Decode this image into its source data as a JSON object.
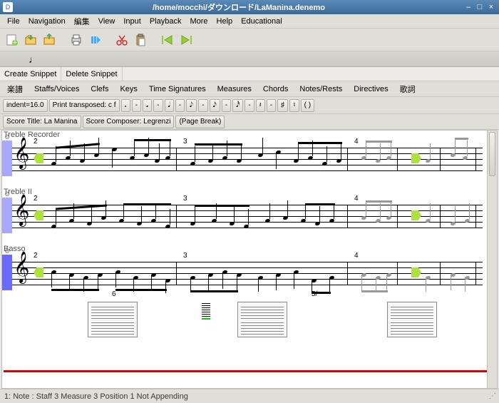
{
  "window": {
    "title": "/home/mocchi/ダウンロード/LaManina.denemo",
    "app_icon": "D"
  },
  "menus": [
    "File",
    "Navigation",
    "編集",
    "View",
    "Input",
    "Playback",
    "More",
    "Help",
    "Educational"
  ],
  "snippet": {
    "create": "Create Snippet",
    "delete": "Delete Snippet"
  },
  "tabs": [
    "楽譜",
    "Staffs/Voices",
    "Clefs",
    "Keys",
    "Time Signatures",
    "Measures",
    "Chords",
    "Notes/Rests",
    "Directives",
    "歌詞"
  ],
  "props": {
    "indent": "indent=16.0",
    "transposed": "Print transposed: c f",
    "glyphs": [
      "𝅗",
      "-",
      "𝅘",
      "-",
      "𝅘𝅥",
      "-",
      "𝅘𝅥𝅮",
      "-",
      "𝅘𝅥𝅯",
      "-",
      "𝅘𝅥𝅰",
      "-",
      "𝄽",
      "-",
      "♯",
      "♮",
      "( )",
      "( )",
      "( )"
    ]
  },
  "props2": {
    "score_title": "Score Title: La Manina",
    "composer": "Score Composer: Legrenzi",
    "page_break": "(Page Break)"
  },
  "staves": [
    {
      "label": "Treble Recorder",
      "meas": [
        "2",
        "3",
        "4"
      ]
    },
    {
      "label": "Treble II",
      "meas": [
        "2",
        "3",
        "4"
      ]
    },
    {
      "label": "Basso",
      "meas": [
        "2",
        "3",
        "4"
      ],
      "extra": [
        "6",
        "5/"
      ]
    }
  ],
  "status": "1: Note : Staff 3 Measure 3 Position 1 Not Appending"
}
